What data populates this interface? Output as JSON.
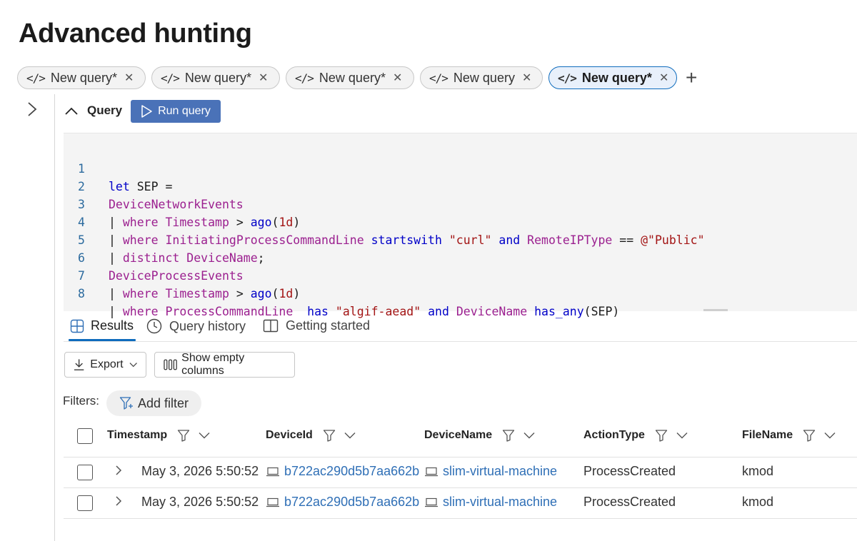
{
  "page": {
    "title": "Advanced hunting"
  },
  "tabs": [
    {
      "label": "New query*",
      "active": false
    },
    {
      "label": "New query*",
      "active": false
    },
    {
      "label": "New query*",
      "active": false
    },
    {
      "label": "New query",
      "active": false
    },
    {
      "label": "New query*",
      "active": true
    }
  ],
  "add_tab_glyph": "+",
  "query_section": {
    "label": "Query",
    "run_label": "Run query"
  },
  "editor": {
    "lines": [
      {
        "num": "1"
      },
      {
        "num": "2"
      },
      {
        "num": "3"
      },
      {
        "num": "4"
      },
      {
        "num": "5"
      },
      {
        "num": "6"
      },
      {
        "num": "7"
      },
      {
        "num": "8"
      }
    ],
    "tokens": {
      "l1_let": "let",
      "l1_rest": " SEP =",
      "l2_table": "DeviceNetworkEvents",
      "l3_pipe": "| ",
      "l3_where": "where",
      "l3_sp": " ",
      "l3_col": "Timestamp",
      "l3_gt": " > ",
      "l3_fn": "ago",
      "l3_open": "(",
      "l3_num": "1d",
      "l3_close": ")",
      "l4_pipe": "| ",
      "l4_where": "where",
      "l4_sp": " ",
      "l4_col": "InitiatingProcessCommandLine",
      "l4_sp2": " ",
      "l4_op": "startswith",
      "l4_sp3": " ",
      "l4_str": "\"curl\"",
      "l4_sp4": " ",
      "l4_and": "and",
      "l4_sp5": " ",
      "l4_col2": "RemoteIPType",
      "l4_eq": " == ",
      "l4_str2": "@\"Public\"",
      "l5_pipe": "| ",
      "l5_distinct": "distinct",
      "l5_sp": " ",
      "l5_col": "DeviceName",
      "l5_semi": ";",
      "l6_table": "DeviceProcessEvents",
      "l7_pipe": "| ",
      "l7_where": "where",
      "l7_sp": " ",
      "l7_col": "Timestamp",
      "l7_gt": " > ",
      "l7_fn": "ago",
      "l7_open": "(",
      "l7_num": "1d",
      "l7_close": ")",
      "l8_pipe": "| ",
      "l8_where": "where",
      "l8_sp": " ",
      "l8_col": "ProcessCommandLine",
      "l8_sp2": "  ",
      "l8_has": "has",
      "l8_sp3": " ",
      "l8_str": "\"algif-aead\"",
      "l8_sp4": " ",
      "l8_and": "and",
      "l8_sp5": " ",
      "l8_col2": "DeviceName",
      "l8_sp6": " ",
      "l8_hasany": "has_any",
      "l8_args": "(SEP)"
    }
  },
  "result_tabs": [
    {
      "label": "Results",
      "icon": "table-icon",
      "active": true
    },
    {
      "label": "Query history",
      "icon": "clock-icon",
      "active": false
    },
    {
      "label": "Getting started",
      "icon": "book-icon",
      "active": false
    }
  ],
  "toolbar": {
    "export_label": "Export",
    "show_empty_label": "Show empty columns"
  },
  "filters": {
    "label": "Filters:",
    "add_filter_label": "Add filter"
  },
  "table": {
    "columns": [
      "Timestamp",
      "DeviceId",
      "DeviceName",
      "ActionType",
      "FileName"
    ],
    "rows": [
      {
        "timestamp": "May 3, 2026 5:50:52",
        "device_id": "b722ac290d5b7aa662b",
        "device_name": "slim-virtual-machine",
        "action_type": "ProcessCreated",
        "file_name": "kmod"
      },
      {
        "timestamp": "May 3, 2026 5:50:52",
        "device_id": "b722ac290d5b7aa662b",
        "device_name": "slim-virtual-machine",
        "action_type": "ProcessCreated",
        "file_name": "kmod"
      }
    ]
  },
  "colors": {
    "accent": "#0f6cbd",
    "run_button": "#4a72b8",
    "link": "#2f6fb6",
    "keyword": "#0000c8",
    "table_name": "#9b1f8f",
    "string": "#a31515"
  }
}
